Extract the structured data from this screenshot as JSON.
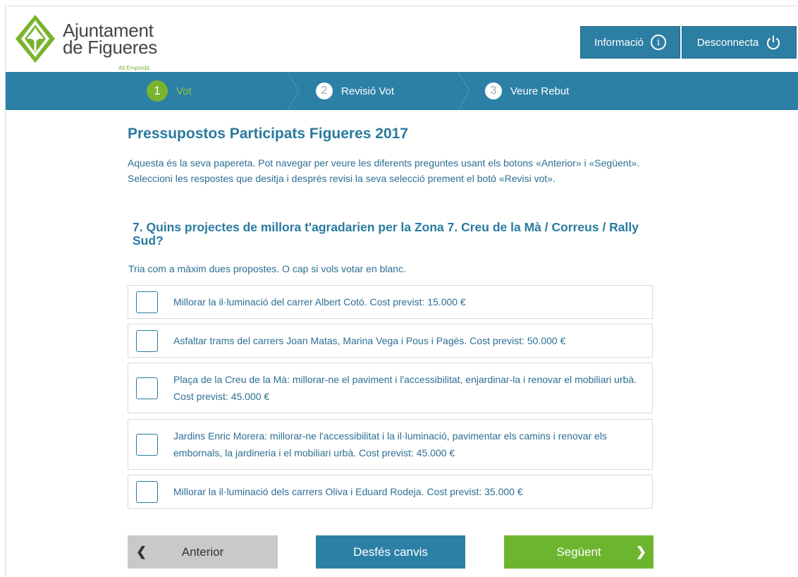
{
  "header": {
    "brand_line1": "Ajuntament",
    "brand_line2": "de Figueres",
    "brand_sub": "Alt Empordà",
    "info_label": "Informació",
    "logout_label": "Desconnecta"
  },
  "steps": [
    {
      "number": "1",
      "label": "Vot",
      "active": true
    },
    {
      "number": "2",
      "label": "Revisió Vot",
      "active": false
    },
    {
      "number": "3",
      "label": "Veure Rebut",
      "active": false
    }
  ],
  "ballot": {
    "title": "Pressupostos Participats Figueres 2017",
    "intro": "Aquesta és la seva papereta. Pot navegar per veure les diferents preguntes usant els botons «Anterior» i «Següent». Seleccioni les respostes que desitja i després revisi la seva selecció prement el botó «Revisi vot».",
    "question": "7. Quins projectes de millora t'agradarien per la Zona 7. Creu de la Mà / Correus / Rally Sud?",
    "hint": "Tria com a màxim dues propostes. O cap si vols votar en blanc.",
    "options": [
      {
        "text": "Millorar la il·luminació del carrer Albert Cotó. Cost previst: 15.000 €",
        "checked": false
      },
      {
        "text": "Asfaltar trams del carrers Joan Matas, Marina Vega i Pous i Pagès. Cost previst: 50.000 €",
        "checked": false
      },
      {
        "text": "Plaça de la Creu de la Mà: millorar-ne el paviment i l'accessibilitat, enjardinar-la i renovar el mobiliari urbà. Cost previst: 45.000 €",
        "checked": false
      },
      {
        "text": "Jardins Enric Morera: millorar-ne l'accessibilitat i la il·luminació, pavimentar els camins i renovar els embornals, la jardineria i el mobiliari urbà. Cost previst: 45.000 €",
        "checked": false
      },
      {
        "text": "Millorar la il·luminació dels carrers Oliva i Eduard Rodeja. Cost previst: 35.000 €",
        "checked": false
      }
    ]
  },
  "nav": {
    "prev_label": "Anterior",
    "undo_label": "Desfés canvis",
    "next_label": "Següent"
  },
  "colors": {
    "primary": "#2c80a6",
    "accent_green": "#6eb52f",
    "text_blue": "#2d6f93"
  }
}
